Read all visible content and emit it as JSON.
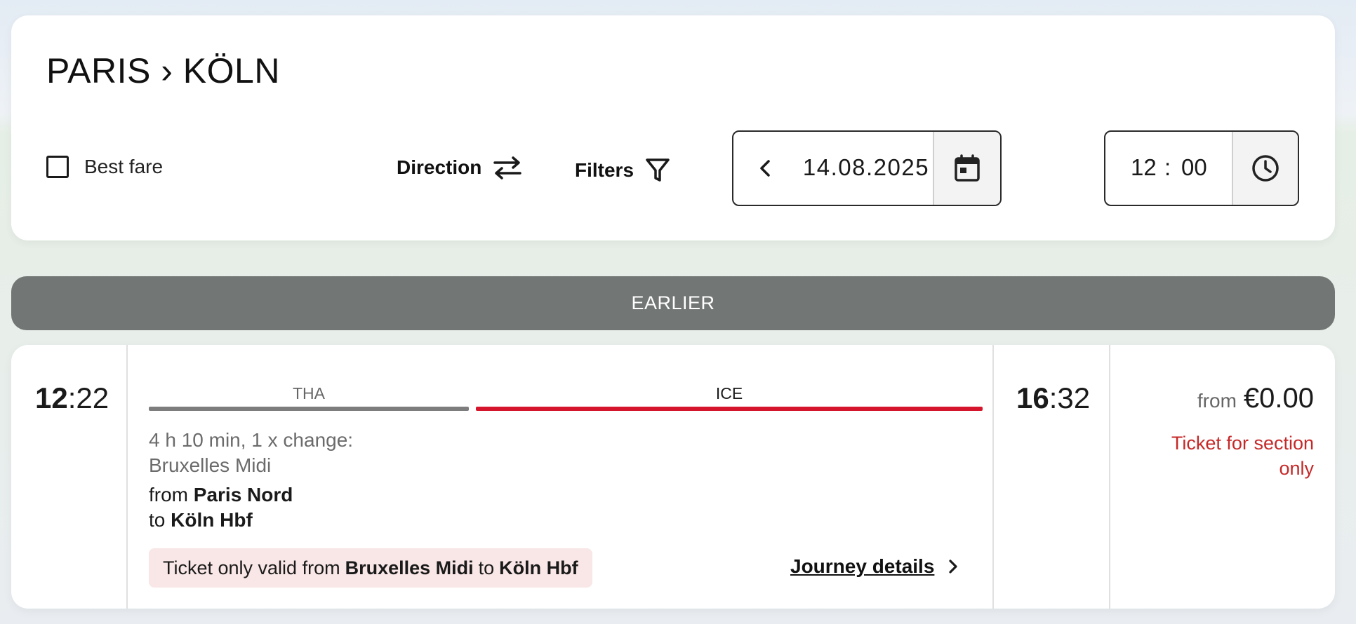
{
  "search": {
    "route_title": "PARIS › KÖLN",
    "best_fare_label": "Best fare",
    "best_fare_checked": false,
    "direction_label": "Direction",
    "filters_label": "Filters",
    "date_value": "14.08.2025",
    "time_hour": "12",
    "time_separator": ":",
    "time_minute": "00",
    "icons": {
      "direction": "swap-arrows-icon",
      "filters": "funnel-icon",
      "date_prev": "chevron-left-icon",
      "date_next": "chevron-right-icon",
      "calendar": "calendar-icon",
      "clock": "clock-icon"
    }
  },
  "earlier_label": "EARLIER",
  "result": {
    "departure_hour": "12",
    "departure_minute": ":22",
    "arrival_hour": "16",
    "arrival_minute": ":32",
    "segments": [
      {
        "label": "THA",
        "color": "#7d7d7d",
        "label_color": "#666666"
      },
      {
        "label": "ICE",
        "color": "#d4152b",
        "label_color": "#1a1a1a"
      }
    ],
    "summary_line1": "4 h 10 min, 1 x change:",
    "summary_line2": "Bruxelles Midi",
    "from_prefix": "from",
    "from_station": "Paris Nord",
    "to_prefix": "to",
    "to_station": "Köln Hbf",
    "notice": {
      "prefix": "Ticket only valid from",
      "from_station": "Bruxelles Midi",
      "middle": "to",
      "to_station": "Köln Hbf"
    },
    "journey_details_label": "Journey details",
    "price_prefix": "from",
    "price_amount": "€0.00",
    "price_note": "Ticket for section only",
    "colors": {
      "price_note": "#c62828",
      "notice_background": "#f9e6e6",
      "earlier_button": "#727674"
    }
  }
}
